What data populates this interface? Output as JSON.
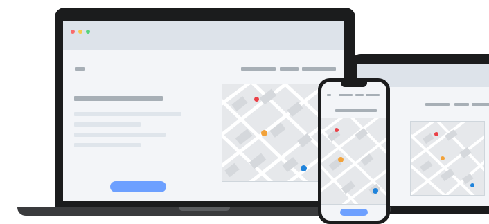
{
  "scene": {
    "description_visible_text": "",
    "background_color": "#ffffff"
  },
  "laptop": {
    "browser": {
      "traffic_lights": [
        {
          "name": "close",
          "color": "#f96b6b"
        },
        {
          "name": "minimize",
          "color": "#f7c94b"
        },
        {
          "name": "maximize",
          "color": "#57d37d"
        }
      ]
    },
    "map_markers": [
      {
        "icon": "restaurant-marker-icon",
        "color": "#ea4047"
      },
      {
        "icon": "car-marker-icon",
        "color": "#f2a23a"
      },
      {
        "icon": "transit-marker-icon",
        "color": "#1f83db"
      }
    ]
  },
  "phone": {
    "map_markers": [
      {
        "icon": "restaurant-marker-icon",
        "color": "#ea4047"
      },
      {
        "icon": "car-marker-icon",
        "color": "#f2a23a"
      },
      {
        "icon": "transit-marker-icon",
        "color": "#1f83db"
      }
    ]
  },
  "colors": {
    "device_frame": "#1b1c1d",
    "screen_bg": "#f3f5f8",
    "chrome_bar": "#dde3ea",
    "placeholder_dark": "#a7afb6",
    "placeholder_light": "#dfe5eb",
    "cta_button": "#6da0ff"
  }
}
